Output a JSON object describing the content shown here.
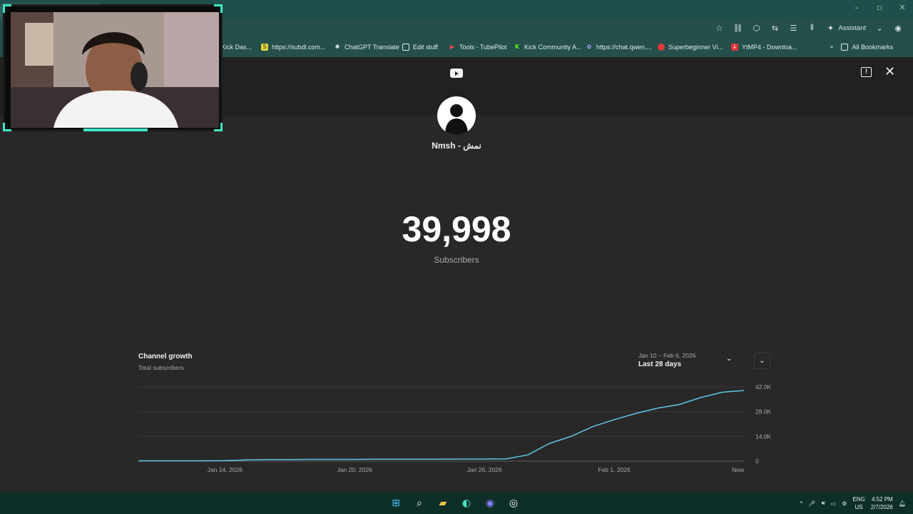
{
  "window": {
    "minimize": "–",
    "maximize": "▫",
    "close": "✕"
  },
  "toolbar": {
    "assistant_label": "Assistant",
    "icons": [
      "star-icon",
      "link-icon",
      "extension-icon",
      "translate-icon",
      "menu-icon",
      "audio-icon"
    ]
  },
  "bookmarks": [
    {
      "label": "Kick Das...",
      "icon": "kick"
    },
    {
      "label": "https://subdl.com...",
      "icon": "subdl"
    },
    {
      "label": "ChatGPT Translate",
      "icon": "chatgpt"
    },
    {
      "label": "Edit stuff",
      "icon": "folder"
    },
    {
      "label": "Tools - TubePilot",
      "icon": "tubepilot"
    },
    {
      "label": "Kick Community A...",
      "icon": "kick"
    },
    {
      "label": "https://chat.qwen....",
      "icon": "qwen"
    },
    {
      "label": "Superbeginner Vi...",
      "icon": "superbeginner"
    },
    {
      "label": "YtMP4 - Downloa...",
      "icon": "ytmp4"
    }
  ],
  "all_bookmarks": "All Bookmarks",
  "page": {
    "channel_name": "Nmsh - نمش",
    "subscriber_count": "39,998",
    "subscriber_label": "Subscribers"
  },
  "growth": {
    "title": "Channel growth",
    "subtitle": "Total subscribers",
    "range_dates": "Jan 10 – Feb 6, 2026",
    "range_label": "Last 28 days"
  },
  "chart_data": {
    "type": "line",
    "title": "Channel growth",
    "subtitle": "Total subscribers",
    "x_tick_labels": [
      "Jan 14, 2026",
      "Jan 20, 2026",
      "Jan 26, 2026",
      "Feb 1, 2026",
      "Now"
    ],
    "y_tick_labels": [
      "0",
      "14.0K",
      "28.0K",
      "42.0K"
    ],
    "ylim": [
      0,
      42000
    ],
    "grid": true,
    "line_color": "#3ea6ff",
    "series": [
      {
        "x": [
          "Jan 10",
          "Jan 11",
          "Jan 12",
          "Jan 13",
          "Jan 14",
          "Jan 15",
          "Jan 16",
          "Jan 17",
          "Jan 18",
          "Jan 19",
          "Jan 20",
          "Jan 21",
          "Jan 22",
          "Jan 23",
          "Jan 24",
          "Jan 25",
          "Jan 26",
          "Jan 27",
          "Jan 28",
          "Jan 29",
          "Jan 30",
          "Jan 31",
          "Feb 1",
          "Feb 2",
          "Feb 3",
          "Feb 4",
          "Feb 5",
          "Feb 6",
          "Now"
        ],
        "values": [
          200,
          200,
          200,
          200,
          300,
          700,
          900,
          900,
          1000,
          1000,
          1000,
          1100,
          1100,
          1100,
          1100,
          1200,
          1200,
          1300,
          3500,
          10000,
          14000,
          19500,
          23500,
          27000,
          30000,
          32000,
          36000,
          39000,
          40000
        ]
      }
    ]
  },
  "taskbar": {
    "lang_top": "ENG",
    "lang_bottom": "US",
    "time": "4:52 PM",
    "date": "2/7/2026"
  }
}
